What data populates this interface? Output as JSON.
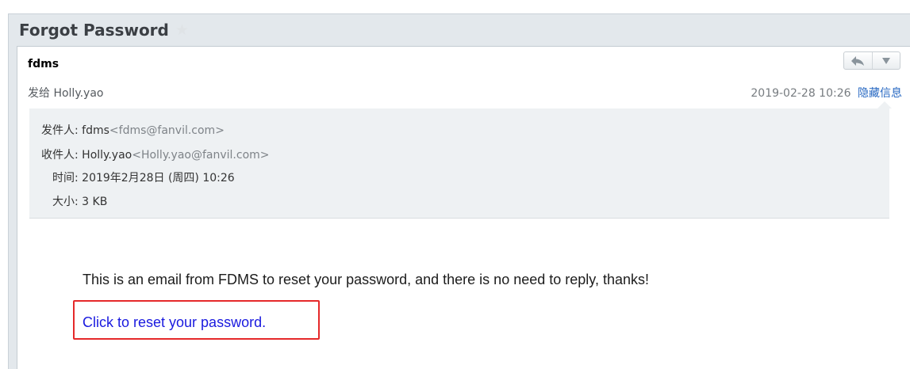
{
  "subject": "Forgot Password",
  "sender_name": "fdms",
  "recipient_line": "发给 Holly.yao",
  "sent_date": "2019-02-28 10:26",
  "hide_details_label": "隐藏信息",
  "details": {
    "from_label": "发件人:",
    "from_name": "fdms",
    "from_addr": "<fdms@fanvil.com>",
    "to_label": "收件人:",
    "to_name": "Holly.yao",
    "to_addr": "<Holly.yao@fanvil.com>",
    "time_label": "时间:",
    "time_value": "2019年2月28日 (周四) 10:26",
    "size_label": "大小:",
    "size_value": "3 KB"
  },
  "body_text": "This is an email from FDMS to reset your password, and there is no need to reply, thanks!",
  "reset_link": "Click to reset your password.",
  "icons": {
    "star": "star-icon",
    "reply": "reply-arrow-icon",
    "more": "dropdown-triangle-icon"
  },
  "colors": {
    "link": "#1a1adf",
    "highlight_box": "#e5292a",
    "hide_link": "#2768c2"
  }
}
